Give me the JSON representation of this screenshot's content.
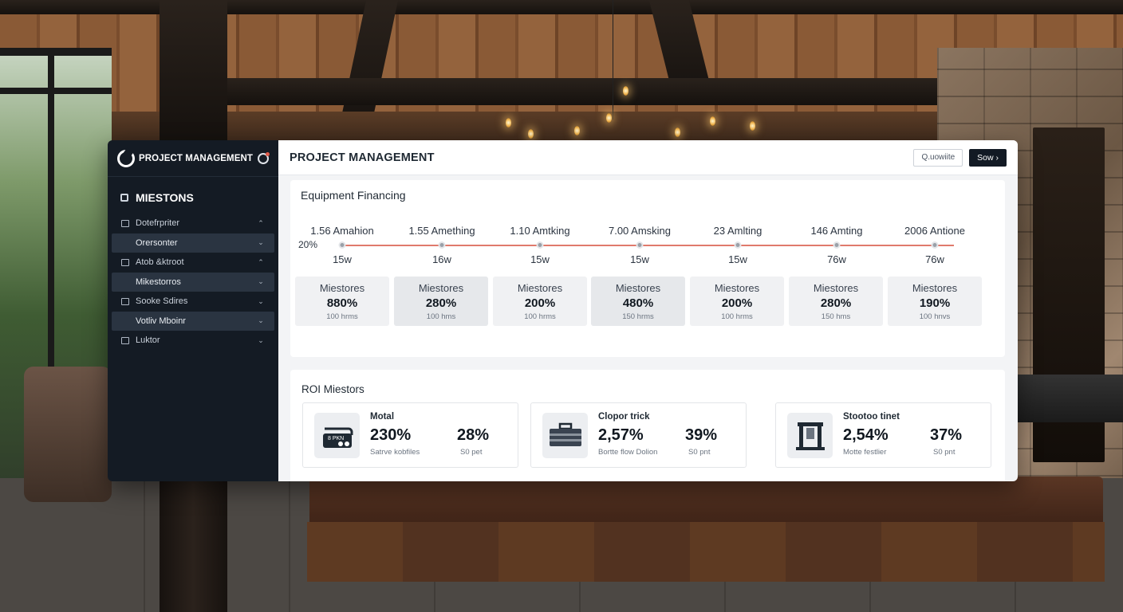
{
  "sidebar": {
    "app_title": "PROJECT MANAGEMENT",
    "section_label": "MIESTONS",
    "items": [
      {
        "label": "Dotefrpriter",
        "chevron": "up",
        "active": false
      },
      {
        "label": "Orersonter",
        "chevron": "down",
        "active": true
      },
      {
        "label": "Atob &ktroot",
        "chevron": "up",
        "active": false
      },
      {
        "label": "Mikestorros",
        "chevron": "down",
        "active": true
      },
      {
        "label": "Sooke Sdires",
        "chevron": "down",
        "active": false
      },
      {
        "label": "Votliv Mboinr",
        "chevron": "down",
        "active": true
      },
      {
        "label": "Luktor",
        "chevron": "down",
        "active": false
      }
    ]
  },
  "header": {
    "title": "PROJECT MANAGEMENT",
    "search_label": "Q.uowiite",
    "save_label": "Sow ›"
  },
  "financing": {
    "title": "Equipment Financing",
    "start_pct": "20%",
    "progress_fraction": 1.0,
    "milestones": [
      {
        "label": "1.56 Amahion",
        "week": "15w",
        "name": "Miestores",
        "value": "880%",
        "sub": "100 hrms",
        "shaded": false
      },
      {
        "label": "1.55 Amething",
        "week": "16w",
        "name": "Miestores",
        "value": "280%",
        "sub": "100 hms",
        "shaded": true
      },
      {
        "label": "1.10 Amtking",
        "week": "15w",
        "name": "Miestores",
        "value": "200%",
        "sub": "100 hrms",
        "shaded": false
      },
      {
        "label": "7.00 Amsking",
        "week": "15w",
        "name": "Miestores",
        "value": "480%",
        "sub": "150 hrms",
        "shaded": true
      },
      {
        "label": "23 Amlting",
        "week": "15w",
        "name": "Miestores",
        "value": "200%",
        "sub": "100 hrms",
        "shaded": false
      },
      {
        "label": "146 Amting",
        "week": "76w",
        "name": "Miestores",
        "value": "280%",
        "sub": "150 hms",
        "shaded": false
      },
      {
        "label": "2006 Antione",
        "week": "76w",
        "name": "Miestores",
        "value": "190%",
        "sub": "100 hnvs",
        "shaded": false
      }
    ]
  },
  "roi": {
    "title": "ROI Miestors",
    "cards": [
      {
        "name": "Motal",
        "value1": "230%",
        "sub1": "Satrve kobfiles",
        "value2": "28%",
        "sub2": "S0 pet",
        "icon": "machine-icon",
        "icon_text": "8 PKN"
      },
      {
        "name": "Clopor trick",
        "value1": "2,57%",
        "sub1": "Bortte flow Dolion",
        "value2": "39%",
        "sub2": "S0 pnt",
        "icon": "toolbox-icon"
      },
      {
        "name": "Stootoo tinet",
        "value1": "2,54%",
        "sub1": "Motte festlier",
        "value2": "37%",
        "sub2": "S0 pnt",
        "icon": "press-icon"
      }
    ]
  }
}
